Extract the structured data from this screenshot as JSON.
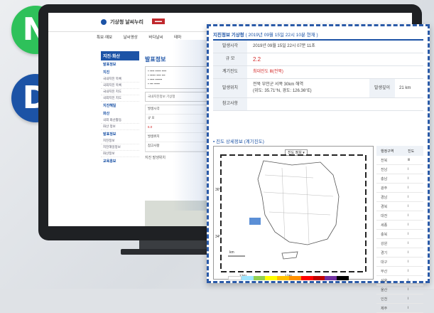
{
  "badges": {
    "n": "N",
    "d": "D"
  },
  "colors": {
    "accent": "#1c53a6",
    "green_badge": "#2ec15a",
    "red_value": "#d32a2a"
  },
  "site": {
    "logo": "기상청 날씨누리",
    "nav": [
      "특보·예보",
      "날씨영상",
      "바다날씨",
      "테마"
    ],
    "left_menu": {
      "title": "지진·화산",
      "items": [
        "발표정보",
        "지진",
        "국내지진 목록",
        "국외지진 목록",
        "국내지진 지도",
        "국외지진 지도",
        "지진해일",
        "화산",
        "국외 화산활동",
        "화산 정보",
        "발표정보",
        "지진정보",
        "지진해일정보",
        "화산정보",
        "교육홍보"
      ]
    },
    "content_title": "발표정보",
    "content_sub": "국내지진정보 기상청",
    "content_table": [
      "발생시각",
      "규 모",
      "6.0",
      "발생위치",
      "참고사항"
    ],
    "content_bottom": "지진 발생위치"
  },
  "panel": {
    "header_title": "지진정보 기상청",
    "header_detail": "( 2019년 09월 15일 22시 10분 현재 )",
    "rows": [
      {
        "key": "발생시각",
        "value": "2019년 09월 15일 22시 07분 11초"
      },
      {
        "key": "규 모",
        "value": "2.2"
      },
      {
        "key": "계기진도",
        "value": "최대진도 Ⅲ(전북)"
      },
      {
        "key": "발생위치",
        "value": "전북 부안군 서쪽 30km 해역",
        "value2": "(위도: 35.71°N, 경도: 126.36°E)",
        "depth_key": "발생깊이",
        "depth_value": "21 km"
      },
      {
        "key": "참고사항",
        "value": ""
      }
    ],
    "section_title": "진도 상세정보 (계기진도)",
    "map_dropdown": "진도 정보",
    "intensity_table": {
      "header": [
        "행정구역",
        "진도"
      ],
      "rows": [
        [
          "전북",
          "Ⅲ"
        ],
        [
          "전남",
          "Ⅰ"
        ],
        [
          "충남",
          "Ⅰ"
        ],
        [
          "광주",
          "Ⅰ"
        ],
        [
          "경남",
          "Ⅰ"
        ],
        [
          "경북",
          "Ⅰ"
        ],
        [
          "대전",
          "Ⅰ"
        ],
        [
          "세종",
          "Ⅰ"
        ],
        [
          "충북",
          "Ⅰ"
        ],
        [
          "강원",
          "Ⅰ"
        ],
        [
          "경기",
          "Ⅰ"
        ],
        [
          "대구",
          "Ⅰ"
        ],
        [
          "부산",
          "Ⅰ"
        ],
        [
          "서울",
          "Ⅰ"
        ],
        [
          "울산",
          "Ⅰ"
        ],
        [
          "인천",
          "Ⅰ"
        ],
        [
          "제주",
          "Ⅰ"
        ]
      ]
    },
    "map_labels": {
      "lat_top": "36°",
      "lat_bottom": "34°",
      "lon_a": "126°",
      "lon_b": "128°",
      "scale": "km"
    }
  }
}
